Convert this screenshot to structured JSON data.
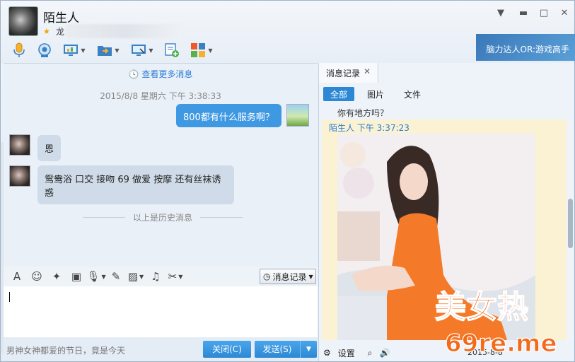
{
  "contact": {
    "name": "陌生人",
    "signature": "龙"
  },
  "toolbar": {
    "icons": [
      "microphone-icon",
      "video-call-icon",
      "screen-share-icon",
      "file-transfer-icon",
      "remote-desktop-icon",
      "note-add-icon",
      "apps-grid-icon"
    ]
  },
  "ad_banner": "脑力达人OR:游戏高手",
  "chat": {
    "more_messages": "查看更多消息",
    "timestamp": "2015/8/8 星期六 下午 3:38:33",
    "my_message": "800都有什么服务啊？",
    "their_message_1": "恩",
    "their_message_2": "鸳鸯浴 口交 接吻 69 做爱 按摩 还有丝袜诱惑",
    "history_divider": "以上是历史消息"
  },
  "input_toolbar": {
    "history_button": "消息记录"
  },
  "footer": {
    "tip": "男神女神都爱的节日，竟是今天",
    "close": "关闭(C)",
    "send": "发送(S)"
  },
  "history_panel": {
    "tab_label": "消息记录",
    "filters": [
      "全部",
      "图片",
      "文件"
    ],
    "prev_message": "你有地方吗？",
    "header": "陌生人  下午 3:37:23",
    "settings": "设置",
    "date": "2015-8-8"
  },
  "watermark": {
    "line1": "美女热",
    "line2": "69re.me"
  },
  "colors": {
    "accent": "#2c88d4",
    "link": "#2a7bd6",
    "history_bg": "#fbf2d4"
  }
}
